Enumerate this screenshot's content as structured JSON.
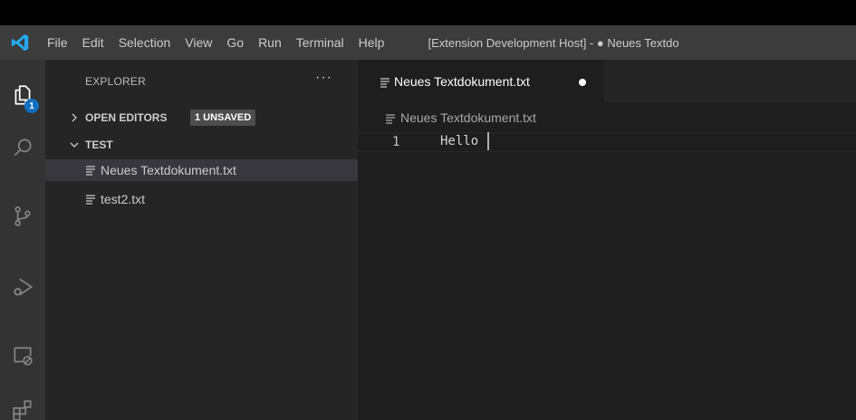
{
  "menu": [
    "File",
    "Edit",
    "Selection",
    "View",
    "Go",
    "Run",
    "Terminal",
    "Help"
  ],
  "window_title": "[Extension Development Host] - ● Neues Textdo",
  "activity_bar": {
    "icons": [
      "explorer-icon",
      "search-icon",
      "source-control-icon",
      "run-debug-icon",
      "remote-explorer-icon",
      "extensions-icon"
    ],
    "explorer_badge": "1"
  },
  "sidebar": {
    "title": "EXPLORER",
    "more_label": "···",
    "open_editors": {
      "label": "OPEN EDITORS",
      "badge": "1 UNSAVED"
    },
    "folder": {
      "label": "TEST"
    },
    "files": [
      "Neues Textdokument.txt",
      "test2.txt"
    ]
  },
  "editor": {
    "tab_label": "Neues Textdokument.txt",
    "breadcrumb": "Neues Textdokument.txt",
    "lines": [
      {
        "number": "1",
        "text": "Hello"
      }
    ]
  },
  "colors": {
    "accent": "#0e70c0",
    "titlebar": "#3c3c3c",
    "activitybar": "#333333",
    "sidebar": "#252526",
    "editor": "#1e1e1e"
  }
}
